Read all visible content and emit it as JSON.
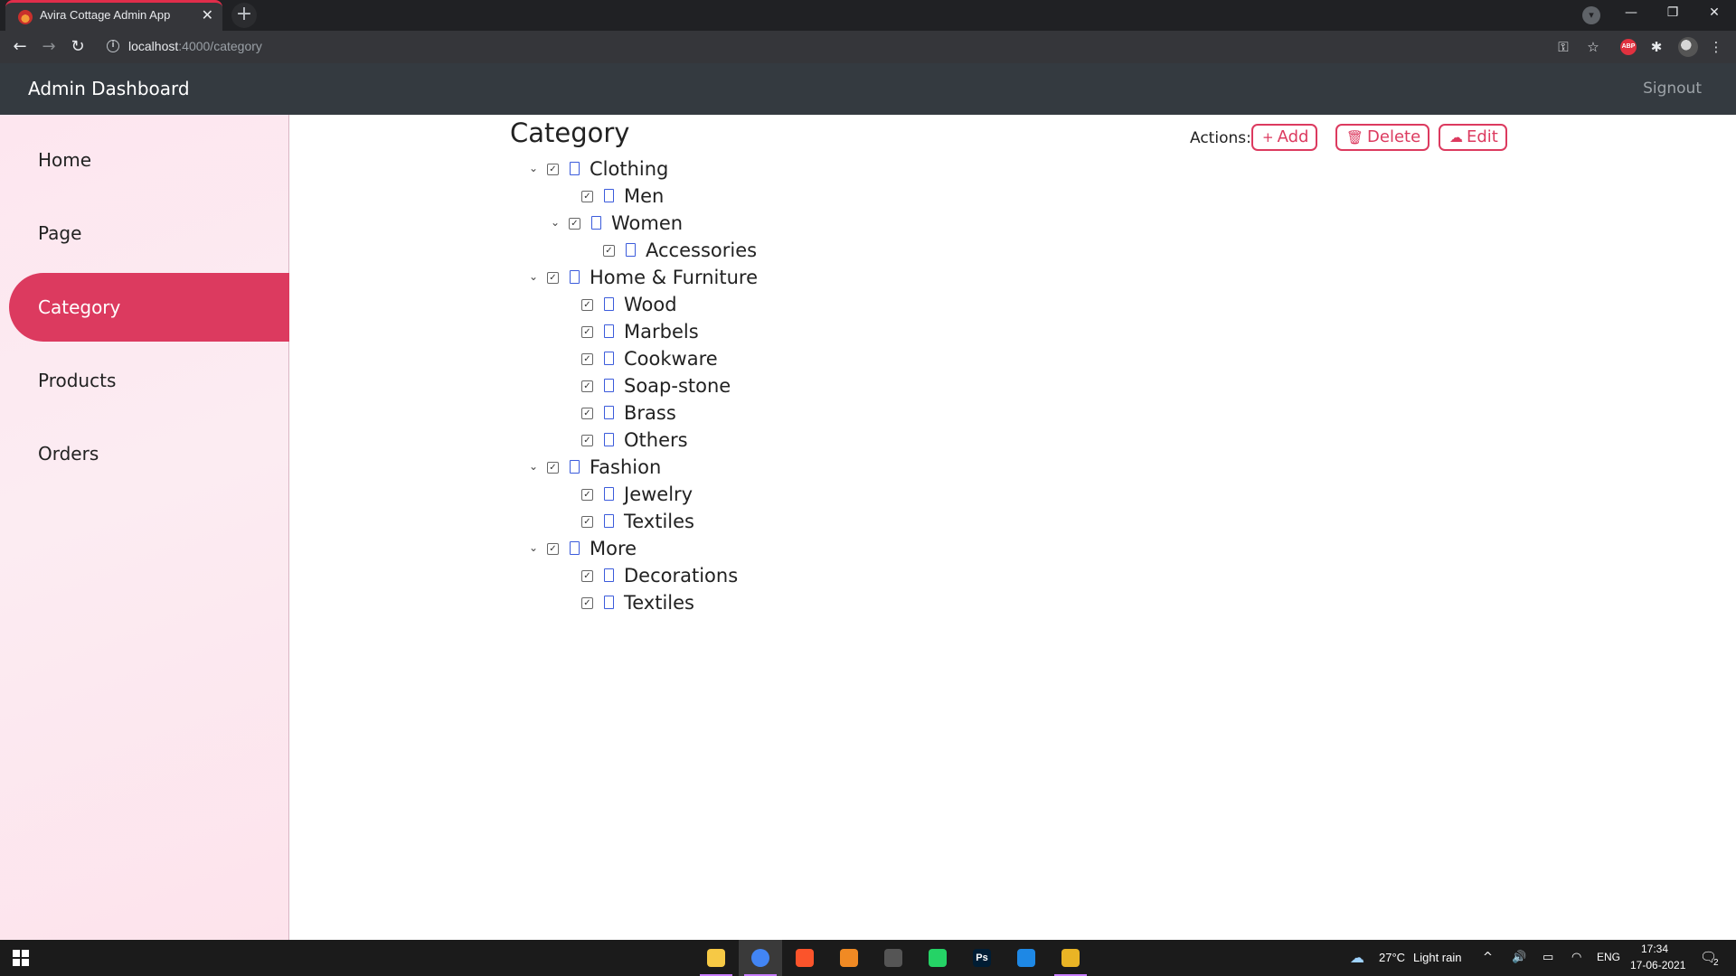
{
  "browser": {
    "tab_title": "Avira Cottage Admin App",
    "url_host": "localhost",
    "url_path": ":4000/category",
    "abp_label": "ABP",
    "icons": [
      "back-arrow-icon",
      "forward-arrow-icon",
      "reload-icon",
      "info-icon",
      "key-icon",
      "star-icon",
      "extensions-icon",
      "menu-icon"
    ]
  },
  "app": {
    "brand": "Admin Dashboard",
    "signout": "Signout",
    "accent_color": "#dc3a5f"
  },
  "sidebar": {
    "items": [
      {
        "label": "Home",
        "active": false
      },
      {
        "label": "Page",
        "active": false
      },
      {
        "label": "Category",
        "active": true
      },
      {
        "label": "Products",
        "active": false
      },
      {
        "label": "Orders",
        "active": false
      }
    ]
  },
  "main": {
    "title": "Category",
    "actions_label": "Actions:",
    "buttons": [
      {
        "label": "Add",
        "icon": "plus-icon"
      },
      {
        "label": "Delete",
        "icon": "trash-icon"
      },
      {
        "label": "Edit",
        "icon": "cloud-upload-icon"
      }
    ],
    "tree": [
      {
        "label": "Clothing",
        "expanded": true,
        "children": [
          {
            "label": "Men"
          },
          {
            "label": "Women",
            "expanded": true,
            "children": [
              {
                "label": "Accessories"
              }
            ]
          }
        ]
      },
      {
        "label": "Home & Furniture",
        "expanded": true,
        "children": [
          {
            "label": "Wood"
          },
          {
            "label": "Marbels"
          },
          {
            "label": "Cookware"
          },
          {
            "label": "Soap-stone"
          },
          {
            "label": "Brass"
          },
          {
            "label": "Others"
          }
        ]
      },
      {
        "label": "Fashion",
        "expanded": true,
        "children": [
          {
            "label": "Jewelry"
          },
          {
            "label": "Textiles"
          }
        ]
      },
      {
        "label": "More",
        "expanded": true,
        "children": [
          {
            "label": "Decorations"
          },
          {
            "label": "Textiles"
          }
        ]
      }
    ]
  },
  "taskbar": {
    "apps": [
      {
        "name": "file-explorer",
        "glyph": "",
        "color": "#f6c945"
      },
      {
        "name": "chrome",
        "glyph": "",
        "color": "#4285f4",
        "active": true
      },
      {
        "name": "brave",
        "glyph": "",
        "color": "#fb542b"
      },
      {
        "name": "vlc",
        "glyph": "",
        "color": "#f08a24"
      },
      {
        "name": "obs",
        "glyph": "",
        "color": "#555555"
      },
      {
        "name": "whatsapp",
        "glyph": "",
        "color": "#25d366"
      },
      {
        "name": "photoshop",
        "glyph": "Ps",
        "color": "#001d34"
      },
      {
        "name": "vscode",
        "glyph": "",
        "color": "#1e88e5"
      },
      {
        "name": "git",
        "glyph": "",
        "color": "#e9b425"
      }
    ],
    "weather": "27°C",
    "weather_desc": "Light rain",
    "language": "ENG",
    "time": "17:34",
    "date": "17-06-2021",
    "notification_count": "2"
  }
}
